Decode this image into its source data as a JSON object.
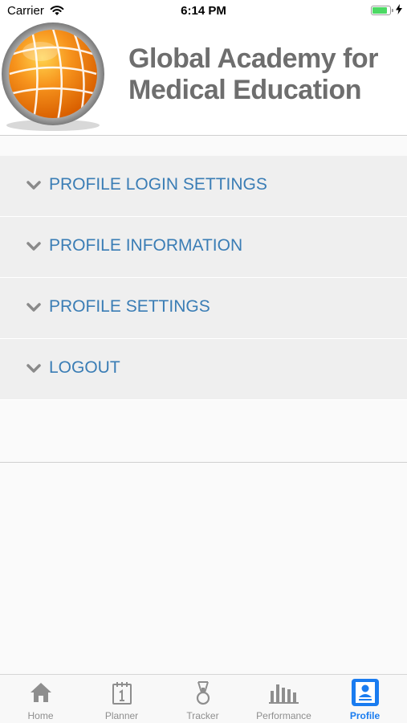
{
  "status_bar": {
    "carrier": "Carrier",
    "time": "6:14 PM"
  },
  "header": {
    "title": "Global Academy for\nMedical Education"
  },
  "menu": {
    "items": [
      {
        "label": "PROFILE LOGIN SETTINGS"
      },
      {
        "label": "PROFILE INFORMATION"
      },
      {
        "label": "PROFILE SETTINGS"
      },
      {
        "label": "LOGOUT"
      }
    ]
  },
  "tab_bar": {
    "tabs": [
      {
        "label": "Home",
        "icon": "home-icon"
      },
      {
        "label": "Planner",
        "icon": "calendar-icon"
      },
      {
        "label": "Tracker",
        "icon": "medal-icon"
      },
      {
        "label": "Performance",
        "icon": "bar-chart-icon"
      },
      {
        "label": "Profile",
        "icon": "profile-card-icon",
        "active": true
      }
    ]
  },
  "colors": {
    "accent": "#3a7db5",
    "tab_active": "#1a7cf0",
    "battery": "#4cd964",
    "logo": "#f7941d"
  }
}
